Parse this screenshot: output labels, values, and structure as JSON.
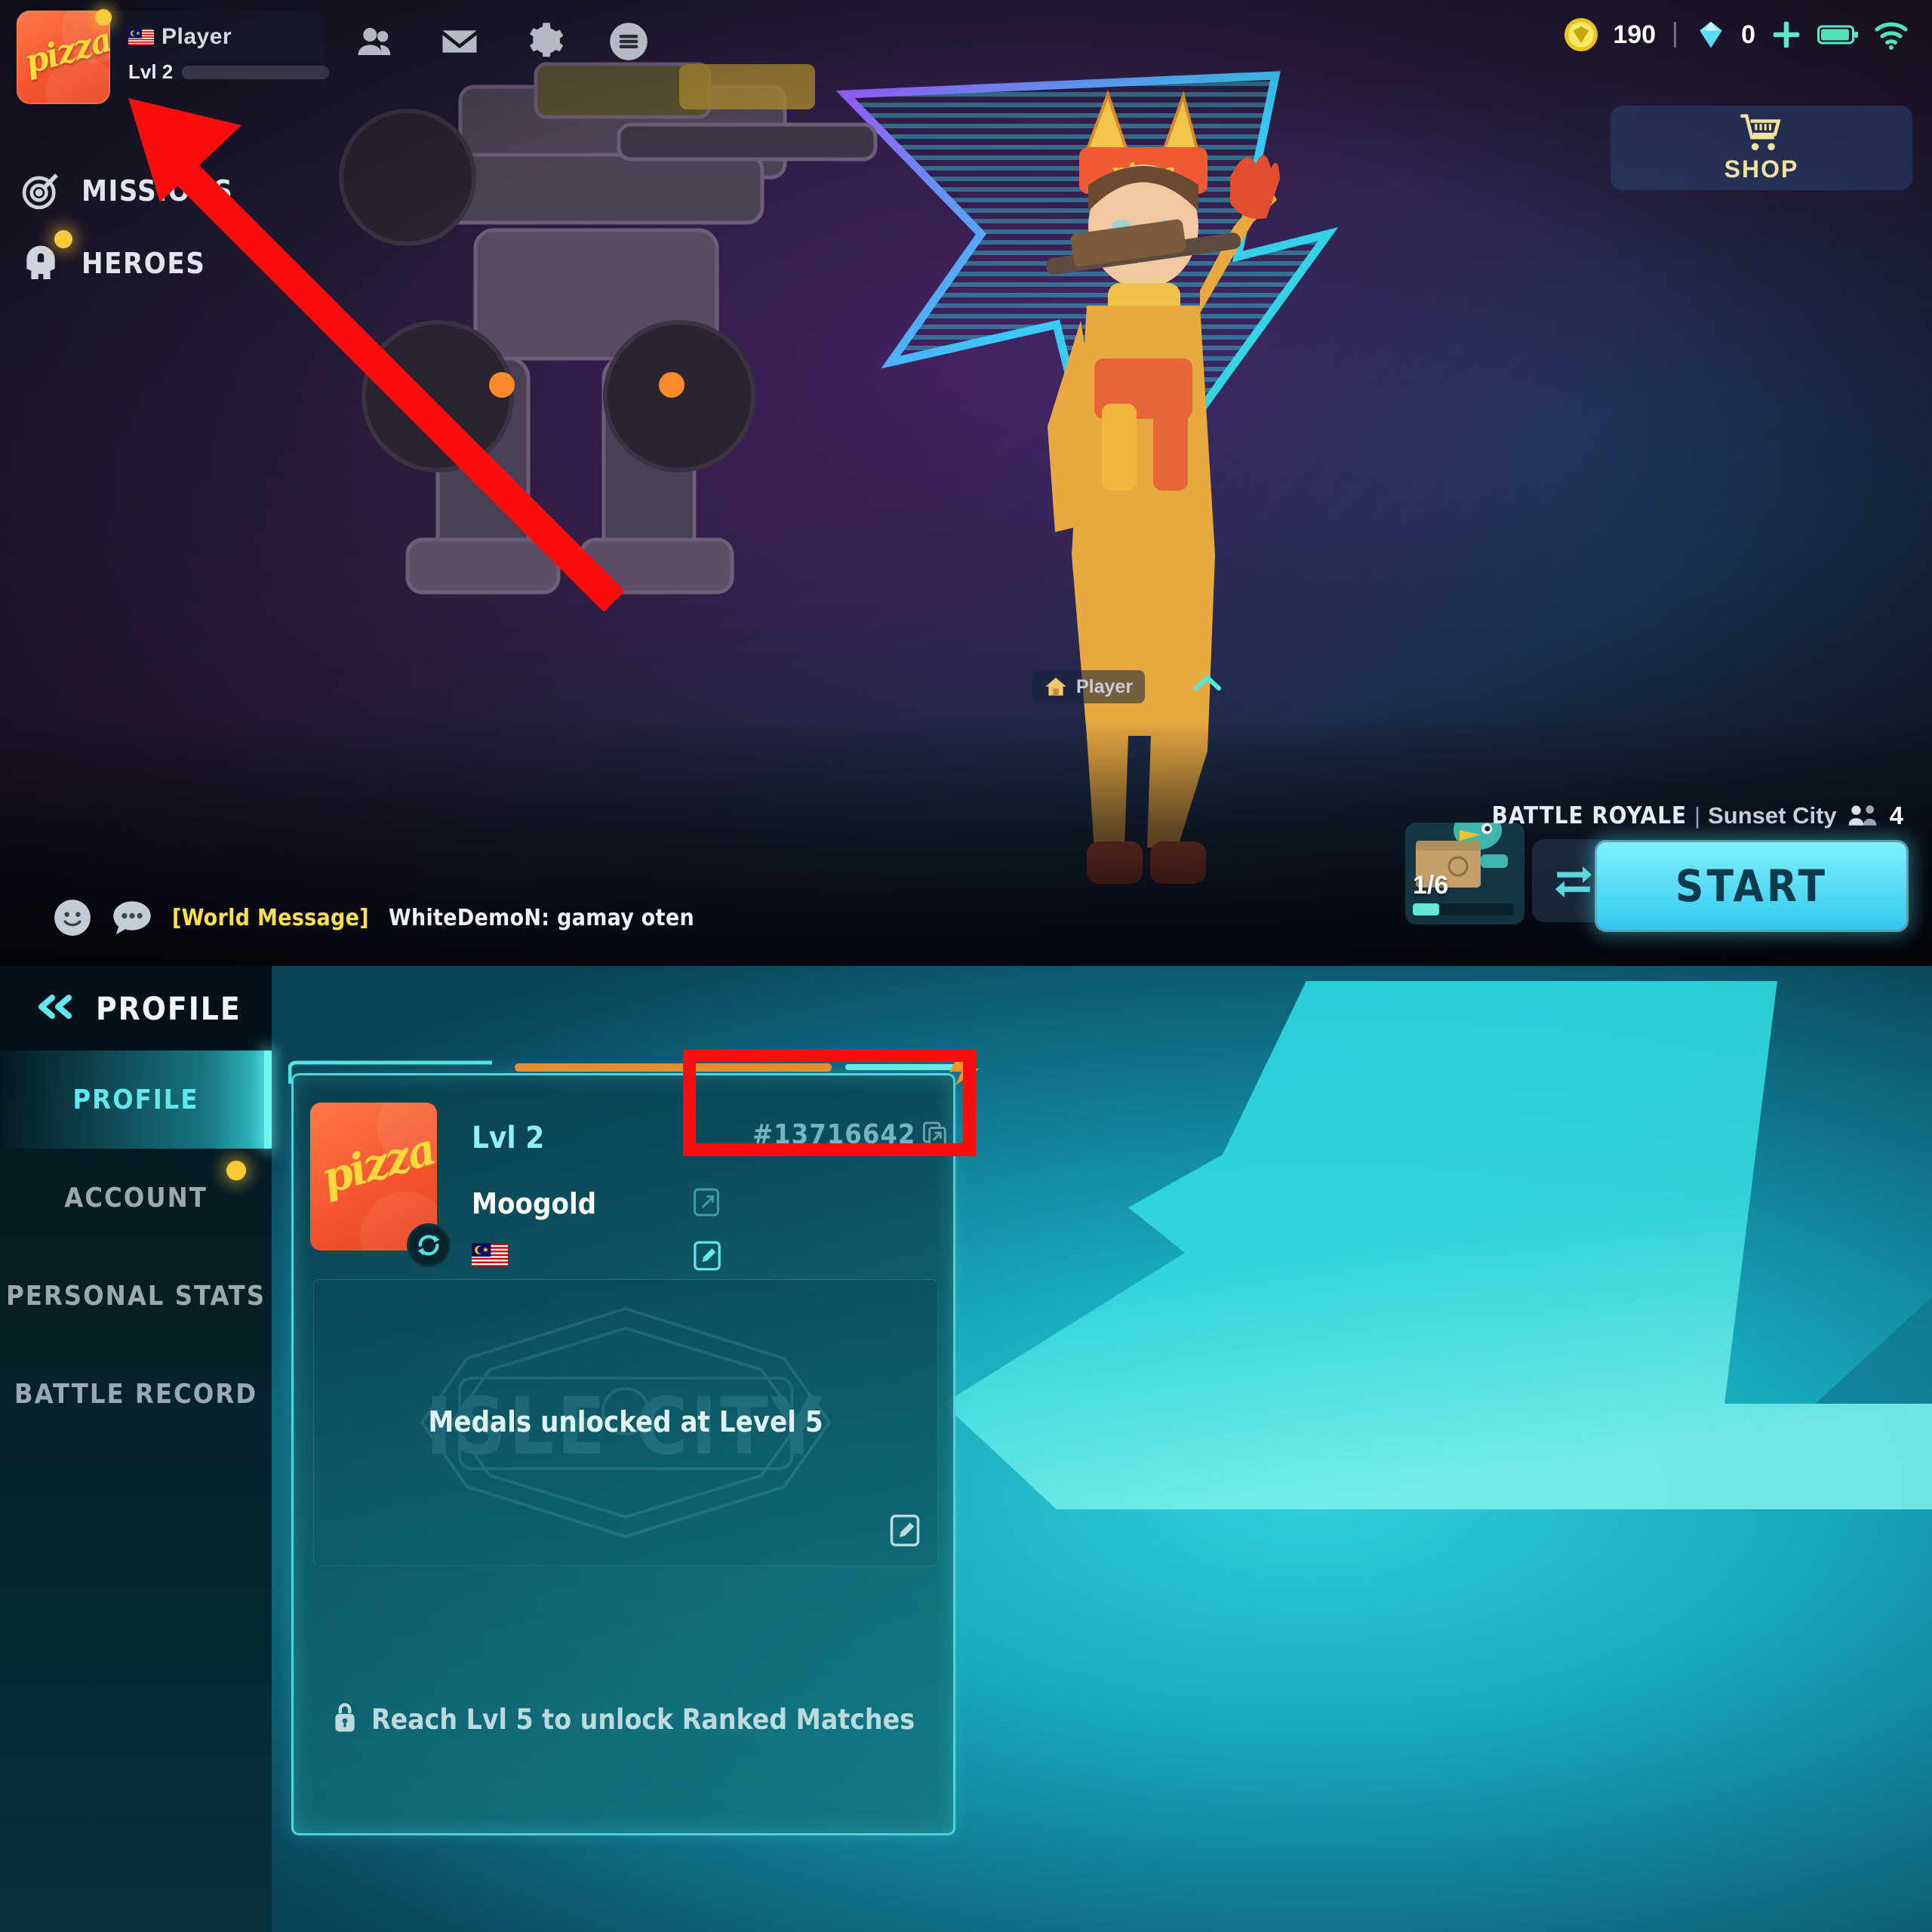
{
  "lobby": {
    "player_chip": {
      "avatar_text": "pizza",
      "name": "Player",
      "level_label": "Lvl 2",
      "flag": "malaysia-flag"
    },
    "top_icons": [
      {
        "name": "friends-icon",
        "label": "Friends"
      },
      {
        "name": "mail-icon",
        "label": "Mail"
      },
      {
        "name": "settings-icon",
        "label": "Settings"
      },
      {
        "name": "menu-icon",
        "label": "Menu"
      }
    ],
    "nav": [
      {
        "label": "MISSIONS",
        "icon": "target-icon",
        "badge": false
      },
      {
        "label": "HEROES",
        "icon": "helmet-icon",
        "badge": true
      }
    ],
    "currency": {
      "gold_icon": "gold-coin-icon",
      "gold": "190",
      "gem_icon": "diamond-icon",
      "gems": "0",
      "add_label": "+",
      "battery_icon": "battery-icon",
      "wifi_icon": "wifi-icon"
    },
    "shop": {
      "label": "SHOP",
      "icon": "shopping-cart-icon"
    },
    "nameplate": {
      "home_icon": "home-icon",
      "name": "Player"
    },
    "chat": {
      "emoji_icon": "smiley-icon",
      "chat_icon": "chat-bubble-icon",
      "tag": "[World Message]",
      "message": "WhiteDemoN: gamay oten"
    },
    "crate": {
      "count": "1/6",
      "progress_pct": 26
    },
    "swap_icon": "swap-arrows-icon",
    "mode": {
      "mode_name": "BATTLE ROYALE",
      "separator": "|",
      "map_name": "Sunset City",
      "squad_icon": "squad-icon",
      "squad_size": "4"
    },
    "start_button": "START"
  },
  "profile": {
    "header": {
      "back_icon": "double-chevron-left-icon",
      "title": "PROFILE"
    },
    "menu": [
      {
        "label": "PROFILE",
        "active": true,
        "badge": false
      },
      {
        "label": "ACCOUNT",
        "active": false,
        "badge": true
      },
      {
        "label": "PERSONAL STATS",
        "active": false,
        "badge": false
      },
      {
        "label": "BATTLE RECORD",
        "active": false,
        "badge": false
      }
    ],
    "card": {
      "avatar_text": "pizza",
      "refresh_icon": "refresh-avatar-icon",
      "level_label": "Lvl 2",
      "player_name": "Moogold",
      "flag": "malaysia-flag",
      "user_id": "#13716642",
      "copy_icon": "copy-icon",
      "edit_name_icon": "edit-icon",
      "edit_flag_icon": "edit-icon",
      "edit_medals_icon": "edit-icon",
      "bolt_icon": "lightning-bolt-icon",
      "medals": {
        "watermark": "ISLE CITY",
        "message": "Medals unlocked at Level 5"
      },
      "ranked_lock": {
        "lock_icon": "lock-icon",
        "message": "Reach Lvl 5 to unlock Ranked Matches"
      }
    }
  },
  "annotations": {
    "arrow_color": "#fc0d0d",
    "box_color": "#fc0d0d",
    "arrow_points_to": "player-chip-avatar",
    "box_highlights": "user-id-row"
  },
  "colors": {
    "accent_cyan": "#5fe8ee",
    "accent_orange": "#f08a22",
    "gold": "#ffc93c",
    "start_blue": "#55dbf4",
    "annotation_red": "#fc0d0d"
  }
}
